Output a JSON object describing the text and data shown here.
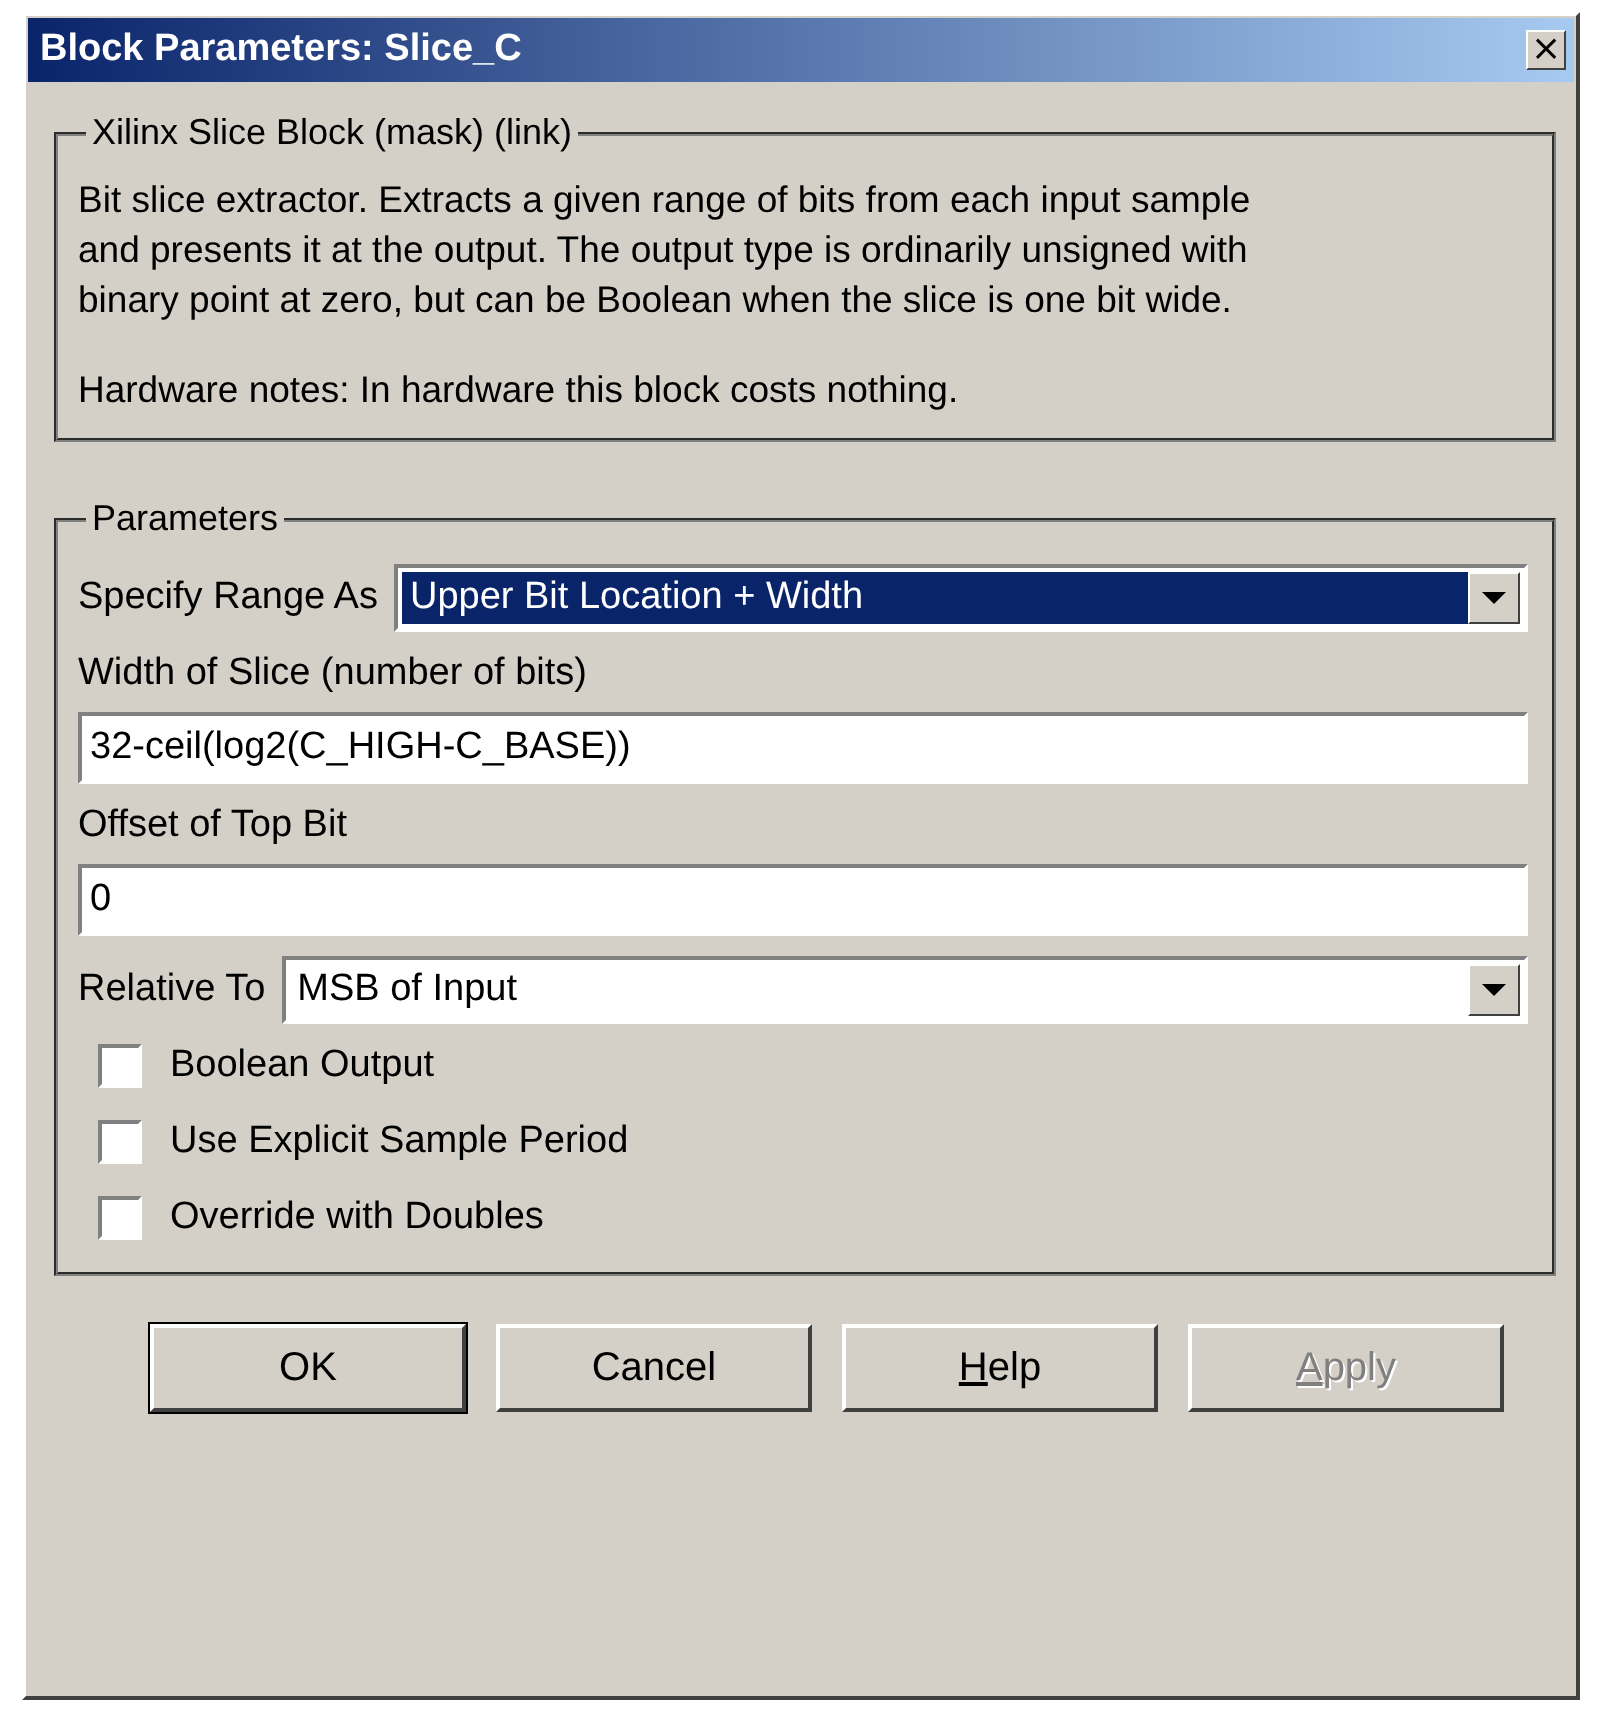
{
  "window": {
    "title": "Block Parameters: Slice_C",
    "close": "×"
  },
  "description": {
    "legend": "Xilinx Slice Block (mask) (link)",
    "paragraphs": [
      "Bit slice extractor.  Extracts a given range of bits from each input sample\nand presents it at the output.  The output type is ordinarily unsigned with\nbinary point at zero, but can be Boolean when the slice is one bit wide.",
      "Hardware notes: In hardware this block costs nothing."
    ]
  },
  "parameters": {
    "legend": "Parameters",
    "fields": [
      {
        "kind": "dropdown",
        "label": "Specify Range As",
        "value": "Upper Bit Location + Width",
        "focused": true
      },
      {
        "kind": "text",
        "label": "Width of Slice (number of bits)",
        "value": "32-ceil(log2(C_HIGH-C_BASE))"
      },
      {
        "kind": "text",
        "label": "Offset of Top Bit",
        "value": "0"
      },
      {
        "kind": "dropdown",
        "label": "Relative To",
        "value": "MSB of Input",
        "focused": false
      },
      {
        "kind": "checkbox",
        "label": "Boolean Output",
        "checked": false
      },
      {
        "kind": "checkbox",
        "label": "Use Explicit Sample Period",
        "checked": false
      },
      {
        "kind": "checkbox",
        "label": "Override with Doubles",
        "checked": false
      }
    ]
  },
  "buttons": [
    {
      "label": "OK",
      "default": true,
      "disabled": false,
      "mnemonic": false
    },
    {
      "label": "Cancel",
      "default": false,
      "disabled": false,
      "mnemonic": false
    },
    {
      "label": "Help",
      "default": false,
      "disabled": false,
      "mnemonic": true
    },
    {
      "label": "Apply",
      "default": false,
      "disabled": true,
      "mnemonic": true
    }
  ]
}
